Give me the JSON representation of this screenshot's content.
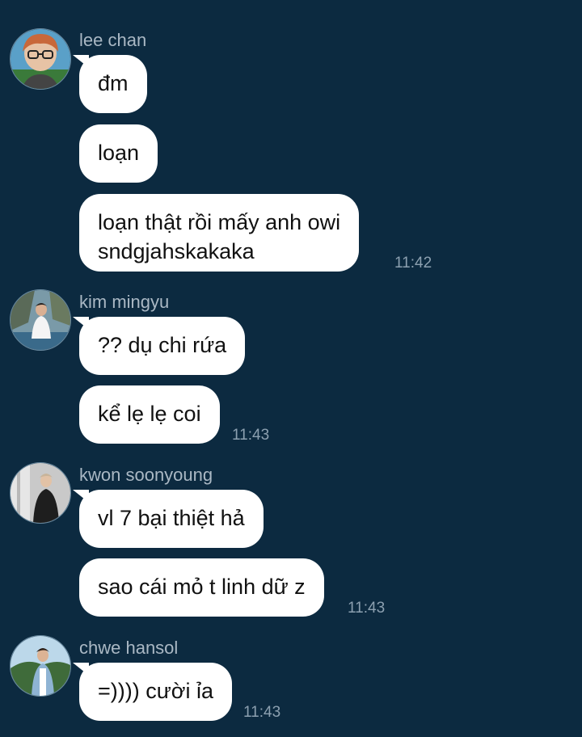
{
  "messages_groups": [
    {
      "sender": "lee chan",
      "avatar_icon": "avatar-lee-chan",
      "messages": [
        "đm",
        "loạn",
        "loạn thật rồi mấy anh owi\nsndgjahskakaka"
      ],
      "time": "11:42"
    },
    {
      "sender": "kim mingyu",
      "avatar_icon": "avatar-kim-mingyu",
      "messages": [
        "?? dụ chi rứa",
        "kể lẹ lẹ coi"
      ],
      "time": "11:43"
    },
    {
      "sender": "kwon soonyoung",
      "avatar_icon": "avatar-kwon-soonyoung",
      "messages": [
        "vl 7 bại thiệt hả",
        "sao cái mỏ t linh dữ z"
      ],
      "time": "11:43"
    },
    {
      "sender": "chwe hansol",
      "avatar_icon": "avatar-chwe-hansol",
      "messages": [
        "=)))) cười ỉa"
      ],
      "time": "11:43"
    }
  ],
  "colors": {
    "background": "#0c2a40",
    "bubble": "#ffffff",
    "sender_text": "#aab8c4",
    "time_text": "#8ca0b0"
  }
}
